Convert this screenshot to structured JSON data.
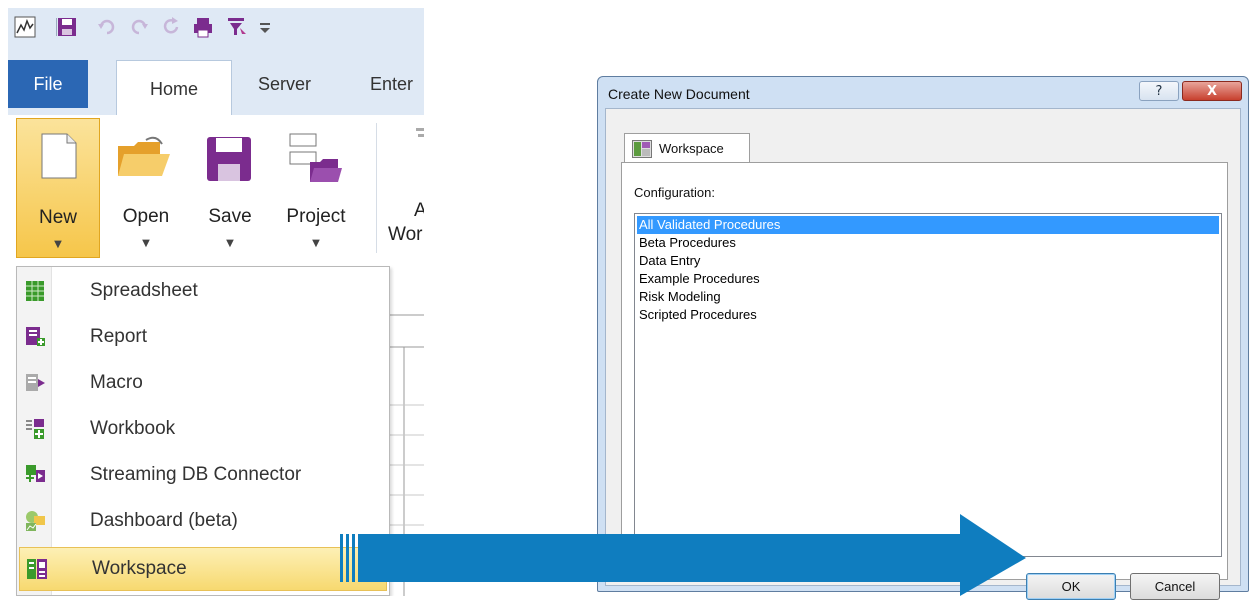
{
  "ribbon": {
    "tabs": {
      "file": "File",
      "home": "Home",
      "server": "Server",
      "enter": "Enter"
    },
    "buttons": {
      "new": "New",
      "open": "Open",
      "save": "Save",
      "project": "Project",
      "partial_top": "A",
      "partial_bottom": "Wor"
    },
    "new_menu": {
      "items": [
        {
          "label": "Spreadsheet",
          "icon": "spreadsheet-icon"
        },
        {
          "label": "Report",
          "icon": "report-icon"
        },
        {
          "label": "Macro",
          "icon": "macro-icon"
        },
        {
          "label": "Workbook",
          "icon": "workbook-icon"
        },
        {
          "label": "Streaming DB Connector",
          "icon": "streaming-db-connector-icon"
        },
        {
          "label": "Dashboard (beta)",
          "icon": "dashboard-icon"
        },
        {
          "label": "Workspace",
          "icon": "workspace-icon"
        }
      ],
      "selected": "Workspace"
    }
  },
  "dialog": {
    "title": "Create New Document",
    "help_symbol": "?",
    "close_symbol": "X",
    "tab_label": "Workspace",
    "configuration_label": "Configuration:",
    "configurations": [
      "All Validated Procedures",
      "Beta Procedures",
      "Data Entry",
      "Example Procedures",
      "Risk Modeling",
      "Scripted Procedures"
    ],
    "selected_configuration": "All Validated Procedures",
    "ok_label": "OK",
    "cancel_label": "Cancel"
  },
  "colors": {
    "file_tab": "#2b67b4",
    "selection_blue": "#3399ff",
    "menu_highlight": "#f7d970",
    "arrow": "#0f7dbf"
  }
}
